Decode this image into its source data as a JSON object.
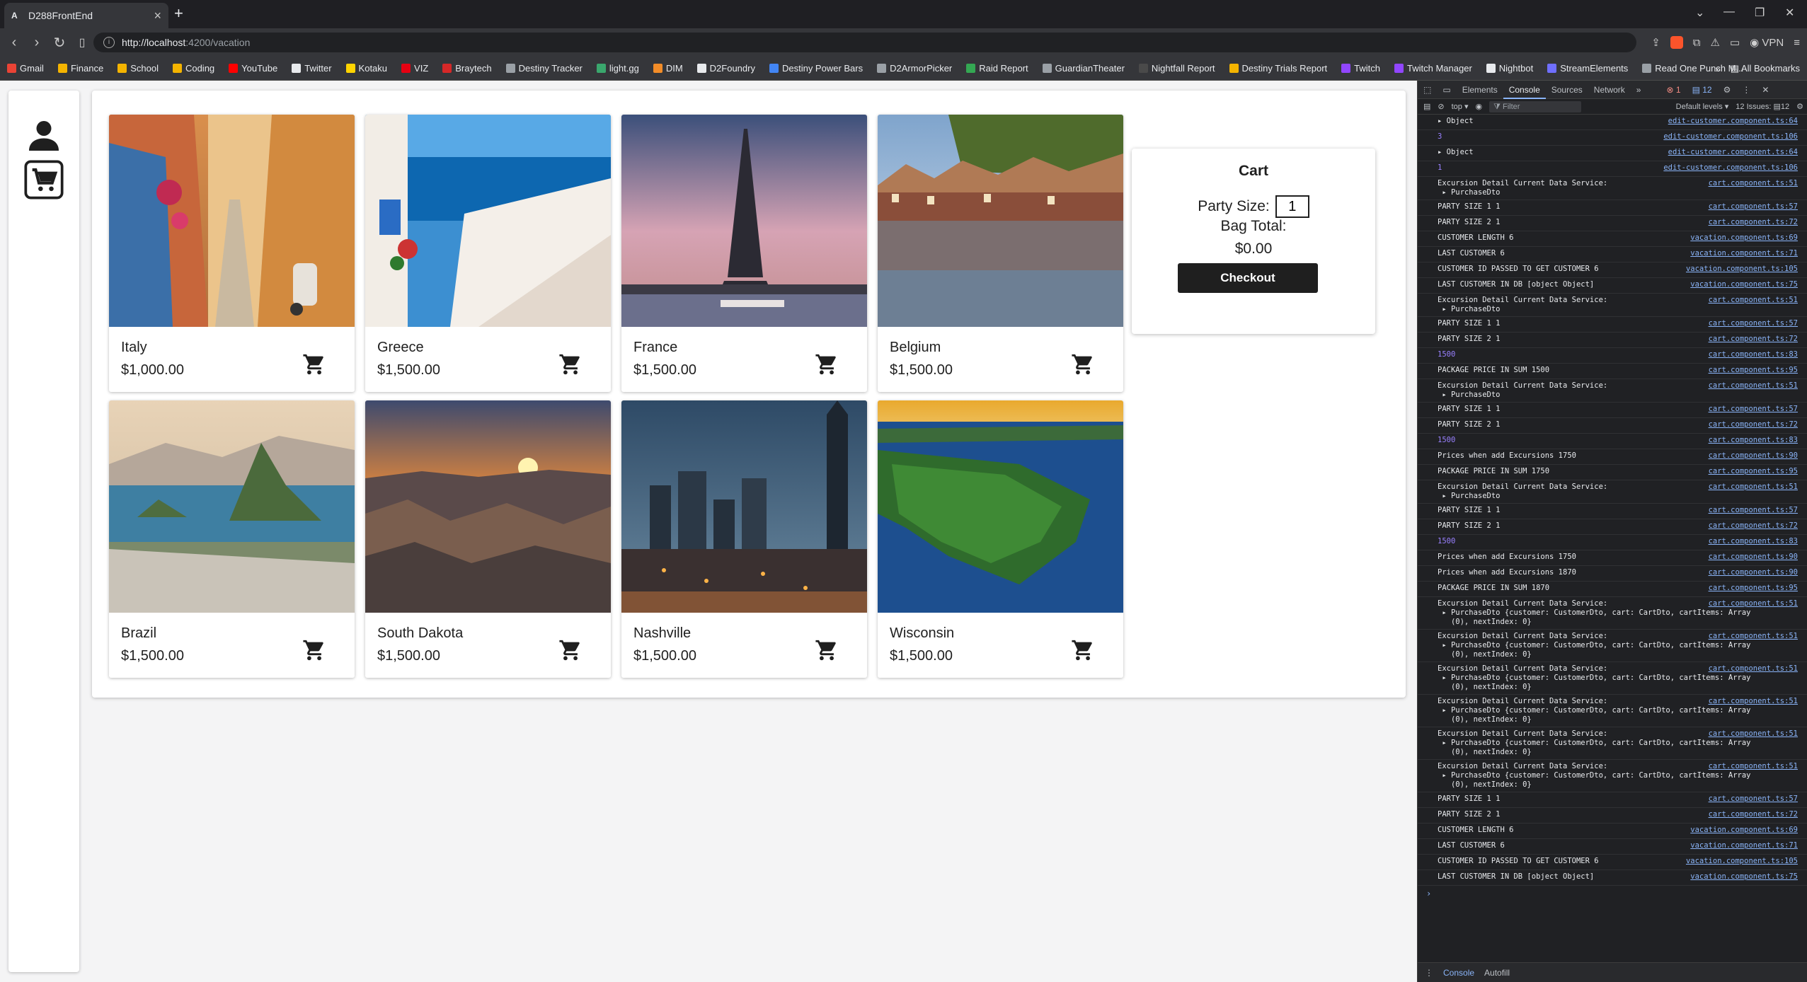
{
  "browser": {
    "tab_title": "D288FrontEnd",
    "tab_favicon": "A",
    "url_host": "http://localhost",
    "url_path": ":4200/vacation",
    "vpn_label": "VPN",
    "all_bookmarks": "All Bookmarks",
    "bookmarks": [
      {
        "label": "Gmail",
        "color": "#ea4335"
      },
      {
        "label": "Finance",
        "color": "#f4b400"
      },
      {
        "label": "School",
        "color": "#f4b400"
      },
      {
        "label": "Coding",
        "color": "#f4b400"
      },
      {
        "label": "YouTube",
        "color": "#ff0000"
      },
      {
        "label": "Twitter",
        "color": "#e8eaed"
      },
      {
        "label": "Kotaku",
        "color": "#ffd400"
      },
      {
        "label": "VIZ",
        "color": "#e60012"
      },
      {
        "label": "Braytech",
        "color": "#d62828"
      },
      {
        "label": "Destiny Tracker",
        "color": "#9aa0a6"
      },
      {
        "label": "light.gg",
        "color": "#3aa76d"
      },
      {
        "label": "DIM",
        "color": "#f28c28"
      },
      {
        "label": "D2Foundry",
        "color": "#e8eaed"
      },
      {
        "label": "Destiny Power Bars",
        "color": "#4285f4"
      },
      {
        "label": "D2ArmorPicker",
        "color": "#9aa0a6"
      },
      {
        "label": "Raid Report",
        "color": "#34a853"
      },
      {
        "label": "GuardianTheater",
        "color": "#9aa0a6"
      },
      {
        "label": "Nightfall Report",
        "color": "#4a4a4a"
      },
      {
        "label": "Destiny Trials Report",
        "color": "#f4b400"
      },
      {
        "label": "Twitch",
        "color": "#9146ff"
      },
      {
        "label": "Twitch Manager",
        "color": "#9146ff"
      },
      {
        "label": "Nightbot",
        "color": "#e8eaed"
      },
      {
        "label": "StreamElements",
        "color": "#6f6fff"
      },
      {
        "label": "Read One Punch M...",
        "color": "#9aa0a6"
      }
    ]
  },
  "vacations": [
    {
      "name": "Italy",
      "price": "$1,000.00",
      "scene": "italy"
    },
    {
      "name": "Greece",
      "price": "$1,500.00",
      "scene": "greece"
    },
    {
      "name": "France",
      "price": "$1,500.00",
      "scene": "france"
    },
    {
      "name": "Belgium",
      "price": "$1,500.00",
      "scene": "belgium"
    },
    {
      "name": "Brazil",
      "price": "$1,500.00",
      "scene": "brazil"
    },
    {
      "name": "South Dakota",
      "price": "$1,500.00",
      "scene": "southdakota"
    },
    {
      "name": "Nashville",
      "price": "$1,500.00",
      "scene": "nashville"
    },
    {
      "name": "Wisconsin",
      "price": "$1,500.00",
      "scene": "wisconsin"
    }
  ],
  "cart": {
    "title": "Cart",
    "party_size_label": "Party Size:",
    "party_size_value": "1",
    "bag_total_label": "Bag Total:",
    "bag_total_value": "$0.00",
    "checkout_label": "Checkout"
  },
  "devtools": {
    "tabs": [
      "Elements",
      "Console",
      "Sources",
      "Network"
    ],
    "active_tab": "Console",
    "error_count": "1",
    "message_count": "12",
    "context": "top",
    "filter_placeholder": "Filter",
    "levels": "Default levels",
    "issues": "12 Issues:",
    "issues_count": "12",
    "bottom_tabs": [
      "Console",
      "Autofill"
    ],
    "logs": [
      {
        "msg": "▸ Object",
        "src": "edit-customer.component.ts:64"
      },
      {
        "msg": "3",
        "src": "edit-customer.component.ts:106",
        "num": true
      },
      {
        "msg": "▸ Object",
        "src": "edit-customer.component.ts:64"
      },
      {
        "msg": "1",
        "src": "edit-customer.component.ts:106",
        "num": true
      },
      {
        "msg": "Excursion Detail Current Data Service:\n ▸ PurchaseDto",
        "src": "cart.component.ts:51"
      },
      {
        "msg": "PARTY SIZE 1 1",
        "src": "cart.component.ts:57"
      },
      {
        "msg": "PARTY SIZE 2 1",
        "src": "cart.component.ts:72"
      },
      {
        "msg": "CUSTOMER LENGTH 6",
        "src": "vacation.component.ts:69"
      },
      {
        "msg": "LAST CUSTOMER 6",
        "src": "vacation.component.ts:71"
      },
      {
        "msg": "CUSTOMER ID PASSED TO GET CUSTOMER 6",
        "src": "vacation.component.ts:105"
      },
      {
        "msg": "LAST CUSTOMER IN DB [object Object]",
        "src": "vacation.component.ts:75"
      },
      {
        "msg": "Excursion Detail Current Data Service:\n ▸ PurchaseDto",
        "src": "cart.component.ts:51"
      },
      {
        "msg": "PARTY SIZE 1 1",
        "src": "cart.component.ts:57"
      },
      {
        "msg": "PARTY SIZE 2 1",
        "src": "cart.component.ts:72"
      },
      {
        "msg": "1500",
        "src": "cart.component.ts:83",
        "num": true
      },
      {
        "msg": "PACKAGE PRICE IN SUM 1500",
        "src": "cart.component.ts:95"
      },
      {
        "msg": "Excursion Detail Current Data Service:\n ▸ PurchaseDto",
        "src": "cart.component.ts:51"
      },
      {
        "msg": "PARTY SIZE 1 1",
        "src": "cart.component.ts:57"
      },
      {
        "msg": "PARTY SIZE 2 1",
        "src": "cart.component.ts:72"
      },
      {
        "msg": "1500",
        "src": "cart.component.ts:83",
        "num": true
      },
      {
        "msg": "Prices when add Excursions 1750",
        "src": "cart.component.ts:90"
      },
      {
        "msg": "PACKAGE PRICE IN SUM 1750",
        "src": "cart.component.ts:95"
      },
      {
        "msg": "Excursion Detail Current Data Service:\n ▸ PurchaseDto",
        "src": "cart.component.ts:51"
      },
      {
        "msg": "PARTY SIZE 1 1",
        "src": "cart.component.ts:57"
      },
      {
        "msg": "PARTY SIZE 2 1",
        "src": "cart.component.ts:72"
      },
      {
        "msg": "1500",
        "src": "cart.component.ts:83",
        "num": true
      },
      {
        "msg": "Prices when add Excursions 1750",
        "src": "cart.component.ts:90"
      },
      {
        "msg": "Prices when add Excursions 1870",
        "src": "cart.component.ts:90"
      },
      {
        "msg": "PACKAGE PRICE IN SUM 1870",
        "src": "cart.component.ts:95"
      },
      {
        "msg": "Excursion Detail Current Data Service:\n ▸ PurchaseDto {customer: CustomerDto, cart: CartDto, cartItems: Array\n   (0), nextIndex: 0}",
        "src": "cart.component.ts:51"
      },
      {
        "msg": "Excursion Detail Current Data Service:\n ▸ PurchaseDto {customer: CustomerDto, cart: CartDto, cartItems: Array\n   (0), nextIndex: 0}",
        "src": "cart.component.ts:51"
      },
      {
        "msg": "Excursion Detail Current Data Service:\n ▸ PurchaseDto {customer: CustomerDto, cart: CartDto, cartItems: Array\n   (0), nextIndex: 0}",
        "src": "cart.component.ts:51"
      },
      {
        "msg": "Excursion Detail Current Data Service:\n ▸ PurchaseDto {customer: CustomerDto, cart: CartDto, cartItems: Array\n   (0), nextIndex: 0}",
        "src": "cart.component.ts:51"
      },
      {
        "msg": "Excursion Detail Current Data Service:\n ▸ PurchaseDto {customer: CustomerDto, cart: CartDto, cartItems: Array\n   (0), nextIndex: 0}",
        "src": "cart.component.ts:51"
      },
      {
        "msg": "Excursion Detail Current Data Service:\n ▸ PurchaseDto {customer: CustomerDto, cart: CartDto, cartItems: Array\n   (0), nextIndex: 0}",
        "src": "cart.component.ts:51"
      },
      {
        "msg": "PARTY SIZE 1 1",
        "src": "cart.component.ts:57"
      },
      {
        "msg": "PARTY SIZE 2 1",
        "src": "cart.component.ts:72"
      },
      {
        "msg": "CUSTOMER LENGTH 6",
        "src": "vacation.component.ts:69"
      },
      {
        "msg": "LAST CUSTOMER 6",
        "src": "vacation.component.ts:71"
      },
      {
        "msg": "CUSTOMER ID PASSED TO GET CUSTOMER 6",
        "src": "vacation.component.ts:105"
      },
      {
        "msg": "LAST CUSTOMER IN DB [object Object]",
        "src": "vacation.component.ts:75"
      }
    ]
  },
  "icons": {
    "profile": "person-icon",
    "cart": "shopping-cart-icon",
    "add_to_cart": "add-to-cart-icon"
  }
}
